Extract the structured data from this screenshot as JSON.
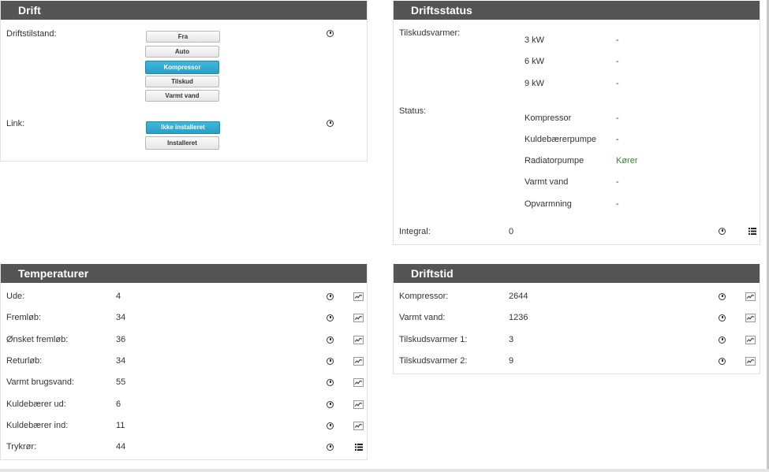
{
  "drift": {
    "title": "Drift",
    "driftstilstand_label": "Driftstilstand:",
    "mode_buttons": [
      "Fra",
      "Auto",
      "Kompressor",
      "Tilskud",
      "Varmt vand"
    ],
    "active_mode": "Kompressor",
    "link_label": "Link:",
    "link_buttons": [
      "Ikke installeret",
      "Installeret"
    ],
    "active_link": "Ikke installeret"
  },
  "driftsstatus": {
    "title": "Driftsstatus",
    "tilskudsvarmer_label": "Tilskudsvarmer:",
    "tilskudsvarmer": [
      {
        "name": "3 kW",
        "value": "-"
      },
      {
        "name": "6 kW",
        "value": "-"
      },
      {
        "name": "9 kW",
        "value": "-"
      }
    ],
    "status_label": "Status:",
    "status": [
      {
        "name": "Kompressor",
        "value": "-"
      },
      {
        "name": "Kuldebærerpumpe",
        "value": "-"
      },
      {
        "name": "Radiatorpumpe",
        "value": "Kører"
      },
      {
        "name": "Varmt vand",
        "value": "-"
      },
      {
        "name": "Opvarmning",
        "value": "-"
      }
    ],
    "integral_label": "Integral:",
    "integral_value": "0"
  },
  "temperaturer": {
    "title": "Temperaturer",
    "rows": [
      {
        "label": "Ude:",
        "value": "4"
      },
      {
        "label": "Fremløb:",
        "value": "34"
      },
      {
        "label": "Ønsket fremløb:",
        "value": "36"
      },
      {
        "label": "Returløb:",
        "value": "34"
      },
      {
        "label": "Varmt brugsvand:",
        "value": "55"
      },
      {
        "label": "Kuldebærer ud:",
        "value": "6"
      },
      {
        "label": "Kuldebærer ind:",
        "value": "11"
      },
      {
        "label": "Trykrør:",
        "value": "44"
      }
    ]
  },
  "driftstid": {
    "title": "Driftstid",
    "rows": [
      {
        "label": "Kompressor:",
        "value": "2644"
      },
      {
        "label": "Varmt vand:",
        "value": "1236"
      },
      {
        "label": "Tilskudsvarmer 1:",
        "value": "3"
      },
      {
        "label": "Tilskudsvarmer 2:",
        "value": "9"
      }
    ]
  },
  "colors": {
    "header_bg": "#555555",
    "active_button": "#2fa8d5",
    "running_status": "#2e8b2e"
  },
  "icons": {
    "history": "clock-icon",
    "graph": "chart-icon",
    "list": "list-icon"
  }
}
